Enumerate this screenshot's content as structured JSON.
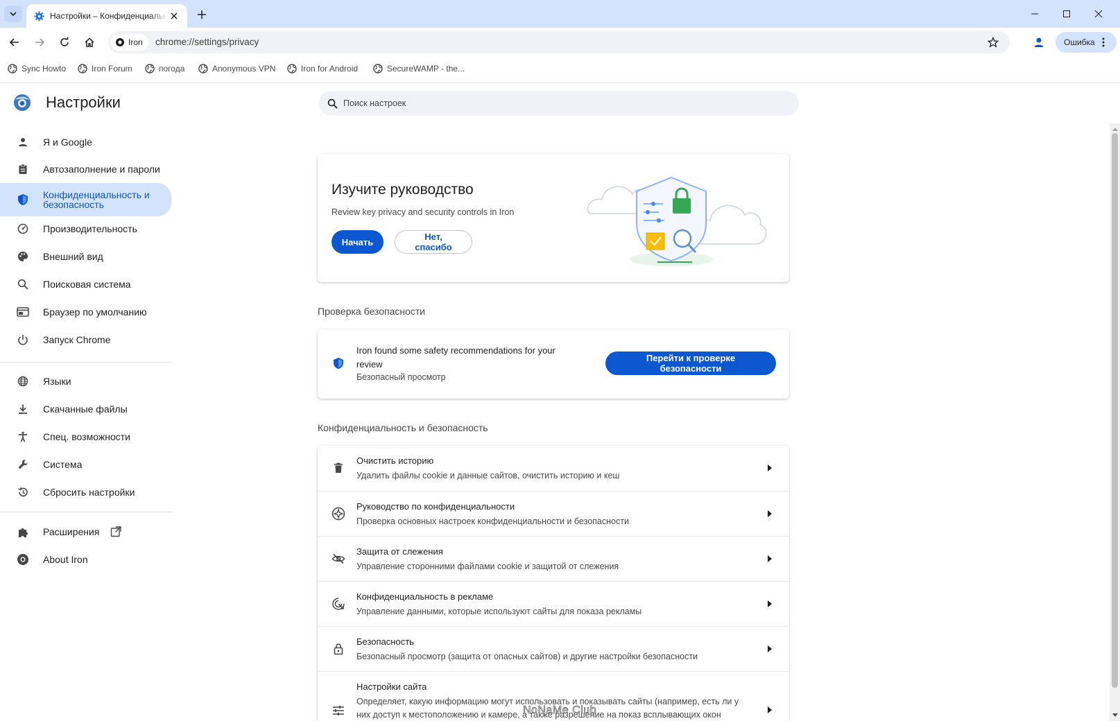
{
  "browser": {
    "tab_title": "Настройки – Конфиденциальность и безопасность",
    "site_chip": "Iron",
    "url": "chrome://settings/privacy",
    "error_label": "Ошибка"
  },
  "bookmarks": [
    "Sync Howto",
    "Iron Forum",
    "погода",
    "Anonymous VPN",
    "Iron for Android",
    "SecureWAMP - the..."
  ],
  "settings": {
    "title": "Настройки",
    "search_placeholder": "Поиск настроек",
    "nav": [
      {
        "label": "Я и Google",
        "icon": "person-icon"
      },
      {
        "label": "Автозаполнение и пароли",
        "icon": "clipboard-icon"
      },
      {
        "label": "Конфиденциальность и безопасность",
        "icon": "shield-icon",
        "active": true
      },
      {
        "label": "Производительность",
        "icon": "speedometer-icon"
      },
      {
        "label": "Внешний вид",
        "icon": "palette-icon"
      },
      {
        "label": "Поисковая система",
        "icon": "search-icon"
      },
      {
        "label": "Браузер по умолчанию",
        "icon": "browser-window-icon"
      },
      {
        "label": "Запуск Chrome",
        "icon": "power-icon"
      },
      {
        "label": "Языки",
        "icon": "globe-icon"
      },
      {
        "label": "Скачанные файлы",
        "icon": "download-icon"
      },
      {
        "label": "Спец. возможности",
        "icon": "accessibility-icon"
      },
      {
        "label": "Система",
        "icon": "wrench-icon"
      },
      {
        "label": "Сбросить настройки",
        "icon": "history-reset-icon"
      },
      {
        "label": "Расширения",
        "icon": "puzzle-icon"
      },
      {
        "label": "About Iron",
        "icon": "iron-logo-icon"
      }
    ]
  },
  "guide_card": {
    "title": "Изучите руководство",
    "subtitle": "Review key privacy and security controls in Iron",
    "start_button": "Начать",
    "dismiss_button": "Нет, спасибо"
  },
  "safety_check": {
    "section_title": "Проверка безопасности",
    "message": "Iron found some safety recommendations for your review",
    "detail": "Безопасный просмотр",
    "button": "Перейти к проверке безопасности"
  },
  "privacy_section": {
    "title": "Конфиденциальность и безопасность",
    "rows": [
      {
        "title": "Очистить историю",
        "subtitle": "Удалить файлы cookie и данные сайтов, очистить историю и кеш",
        "icon": "trash-icon"
      },
      {
        "title": "Руководство по конфиденциальности",
        "subtitle": "Проверка основных настроек конфиденциальности и безопасности",
        "icon": "compass-icon"
      },
      {
        "title": "Защита от слежения",
        "subtitle": "Управление сторонними файлами cookie и защитой от слежения",
        "icon": "eye-off-icon"
      },
      {
        "title": "Конфиденциальность в рекламе",
        "subtitle": "Управление данными, которые используют сайты для показа рекламы",
        "icon": "ad-privacy-icon"
      },
      {
        "title": "Безопасность",
        "subtitle": "Безопасный просмотр (защита от опасных сайтов) и другие настройки безопасности",
        "icon": "lock-icon"
      },
      {
        "title": "Настройки сайта",
        "subtitle": "Определяет, какую информацию могут использовать и показывать сайты (например, есть ли у них доступ к местоположению и камере, а также разрешение на показ всплывающих окон",
        "icon": "sliders-icon"
      }
    ]
  },
  "watermark": "NoNaMe Club",
  "colors": {
    "accent": "#0b57d0",
    "nav_active_bg": "#d3e3fd",
    "tabstrip": "#d3e3fd"
  }
}
